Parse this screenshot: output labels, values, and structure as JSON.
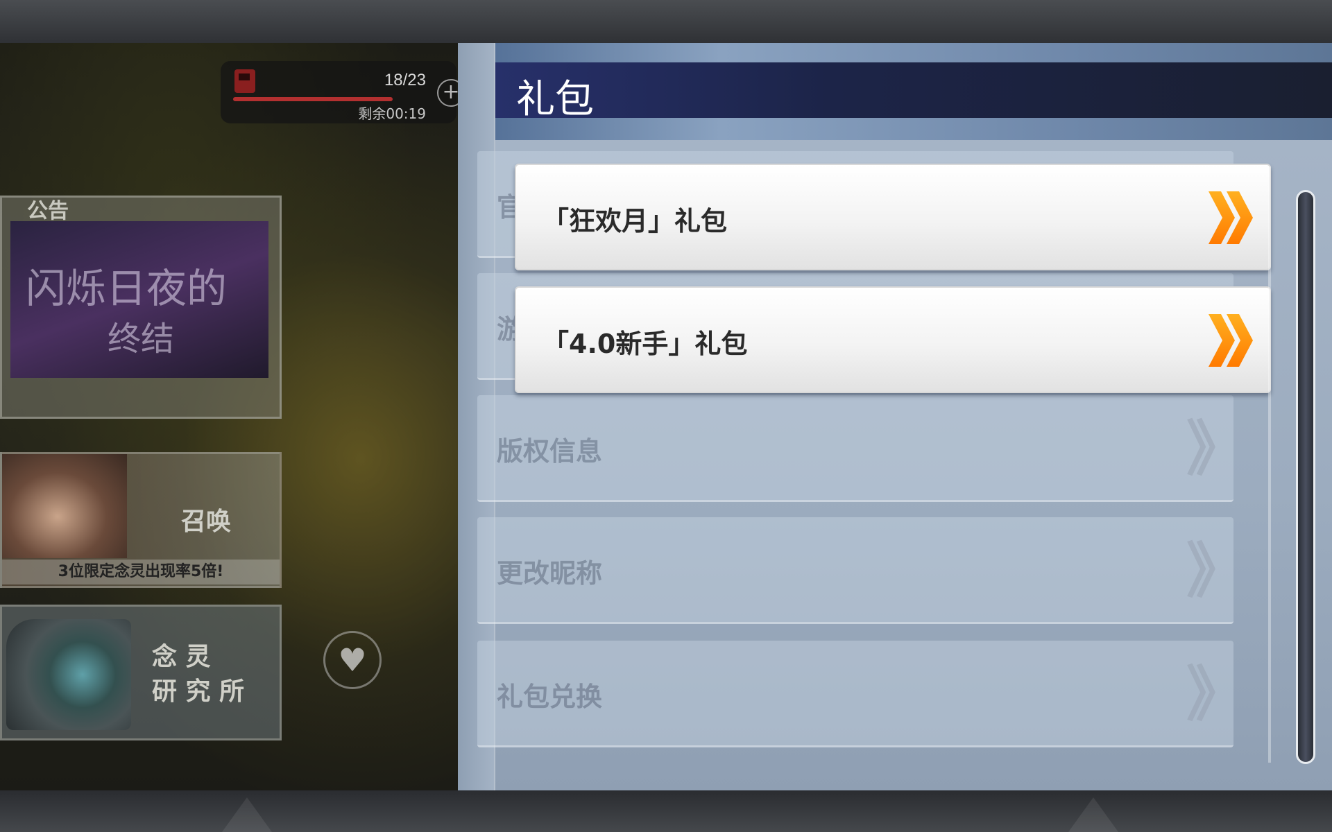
{
  "hud": {
    "fuel_count": "18/23",
    "fuel_timer": "剩余00:19",
    "plus_icon": "plus-icon"
  },
  "notice": {
    "label": "公告",
    "banner_line1": "闪烁日夜的",
    "banner_line2": "终结"
  },
  "summon": {
    "label": "召唤",
    "caption": "3位限定念灵出现率5倍!"
  },
  "lab": {
    "label_line1": "念 灵",
    "label_line2": "研 究 所"
  },
  "panel": {
    "title": "礼包",
    "base_items": [
      {
        "label": "官"
      },
      {
        "label": "游"
      },
      {
        "label": "版权信息"
      },
      {
        "label": "更改昵称"
      },
      {
        "label": "礼包兑换"
      }
    ],
    "gift_items": [
      {
        "label": "「狂欢月」礼包"
      },
      {
        "label": "「4.0新手」礼包"
      }
    ],
    "arrow_glyph": "》",
    "colors": {
      "arrow_orange": "#ff9900",
      "title_bar": "#1c2448"
    }
  }
}
